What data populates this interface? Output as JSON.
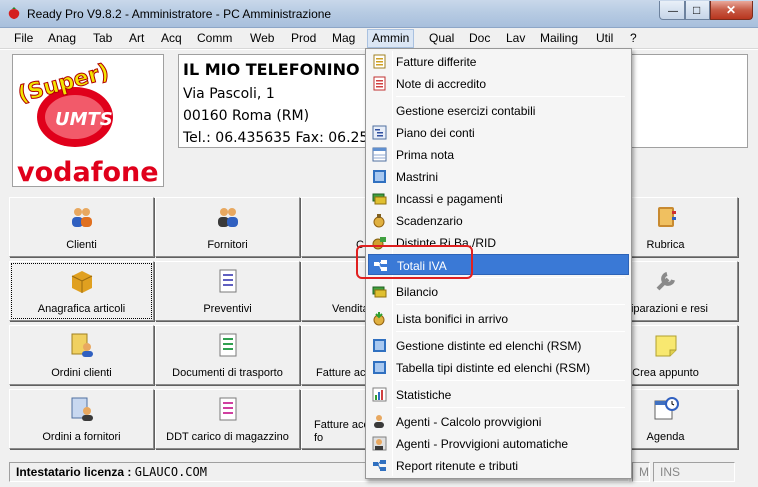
{
  "window": {
    "title": "Ready Pro V9.8.2 - Amministratore - PC Amministrazione",
    "min_glyph": "—",
    "max_glyph": "□",
    "close_glyph": "✕"
  },
  "menubar": {
    "items": [
      "File",
      "Anag",
      "Tab",
      "Art",
      "Acq",
      "Comm",
      "Web",
      "Prod",
      "Mag",
      "Ammin",
      "Qual",
      "Doc",
      "Lav",
      "Mailing",
      "Util",
      "?"
    ],
    "active": "Ammin"
  },
  "logo": {
    "line1": "(Super)",
    "line2": "UMTS",
    "brand": "vodafone"
  },
  "company": {
    "name": "IL MIO TELEFONINO S",
    "address": "Via Pascoli, 1",
    "city": "00160 Roma (RM)",
    "contacts": "Tel.: 06.435635 Fax: 06.25"
  },
  "tiles": {
    "row1": [
      "Clienti",
      "Fornitori",
      "C",
      "",
      "Rubrica"
    ],
    "row2": [
      "Anagrafica articoli",
      "Preventivi",
      "Vendita",
      "",
      "Riparazioni e resi"
    ],
    "row3": [
      "Ordini clienti",
      "Documenti di trasporto",
      "Fatture ac",
      "",
      "Crea appunto"
    ],
    "row4": [
      "Ordini a fornitori",
      "DDT carico di magazzino",
      "Fatture acc fo",
      "",
      "Agenda"
    ]
  },
  "status": {
    "license_label": "Intestatario licenza :",
    "license_value": "GLAUCO.COM",
    "num": "M",
    "ins": "INS"
  },
  "dropdown": {
    "items": [
      {
        "label": "Fatture differite",
        "icon": "invoice-deferred-icon"
      },
      {
        "label": "Note di accredito",
        "icon": "credit-note-icon"
      },
      {
        "label": "Gestione esercizi contabili",
        "icon": ""
      },
      {
        "label": "Piano dei conti",
        "icon": "chart-of-accounts-icon"
      },
      {
        "label": "Prima nota",
        "icon": "ledger-icon"
      },
      {
        "label": "Mastrini",
        "icon": "accounts-icon"
      },
      {
        "label": "Incassi e pagamenti",
        "icon": "payments-icon"
      },
      {
        "label": "Scadenzario",
        "icon": "deadline-icon"
      },
      {
        "label": "Distinte Ri.Ba./RID",
        "icon": "bank-slip-icon"
      },
      {
        "label": "Totali IVA",
        "icon": "vat-totals-icon"
      },
      {
        "label": "Bilancio",
        "icon": "balance-icon"
      },
      {
        "label": "Lista bonifici in arrivo",
        "icon": "incoming-transfers-icon"
      },
      {
        "label": "Gestione distinte ed elenchi (RSM)",
        "icon": "rsm-lists-icon"
      },
      {
        "label": "Tabella tipi distinte ed elenchi (RSM)",
        "icon": "rsm-table-icon"
      },
      {
        "label": "Statistiche",
        "icon": "statistics-icon"
      },
      {
        "label": "Agenti - Calcolo provvigioni",
        "icon": "agent-commission-icon"
      },
      {
        "label": "Agenti - Provvigioni automatiche",
        "icon": "agent-auto-icon"
      },
      {
        "label": "Report ritenute e tributi",
        "icon": "tax-report-icon"
      }
    ],
    "highlighted": "Totali IVA"
  },
  "colors": {
    "highlight": "#3a79d6",
    "annotation": "#e02020",
    "brand_red": "#e0001b"
  }
}
